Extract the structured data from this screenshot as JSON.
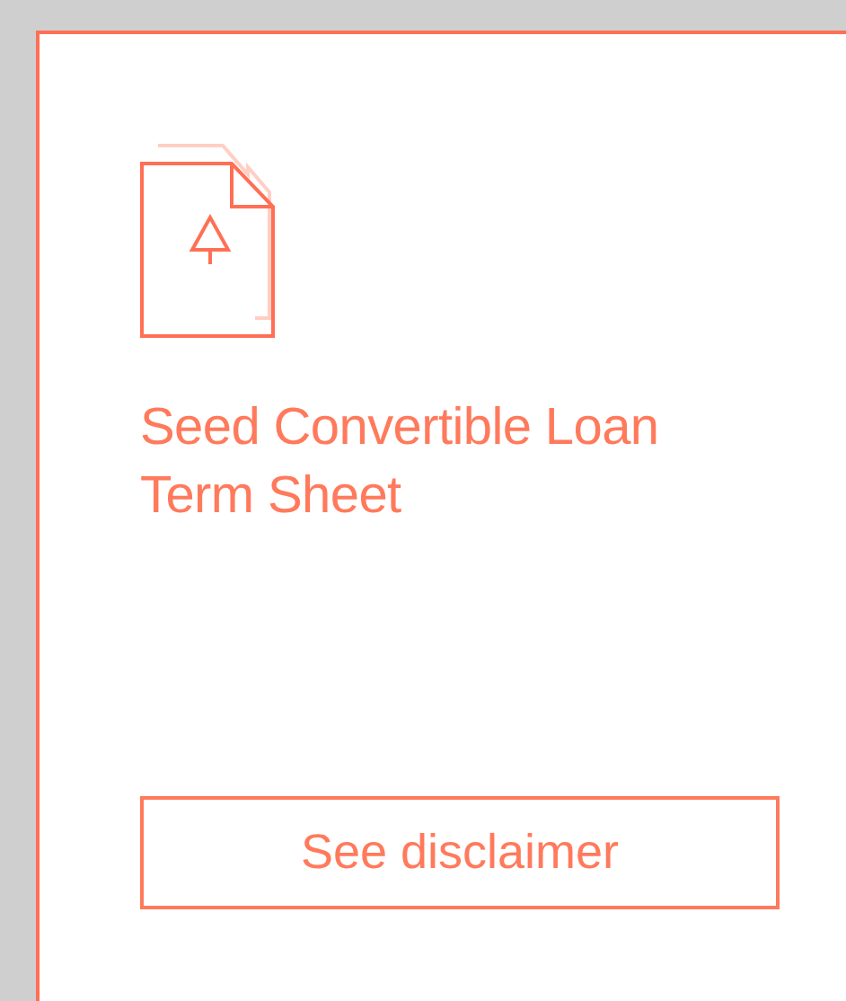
{
  "card": {
    "title": "Seed Convertible Loan Term Sheet",
    "button": "See disclaimer"
  }
}
